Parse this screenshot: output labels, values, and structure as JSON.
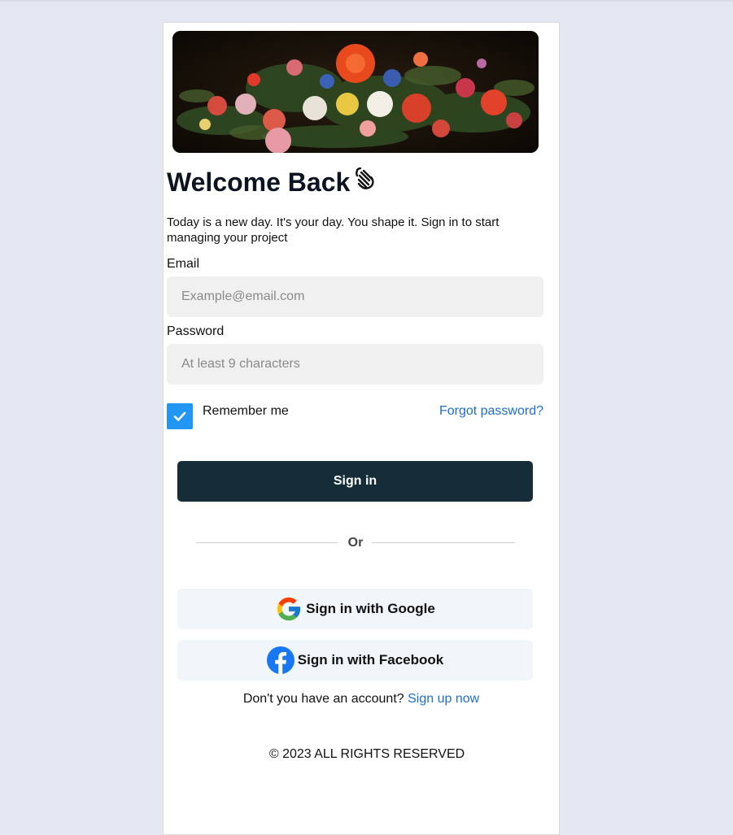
{
  "hero": {
    "alt": "Still life painting of a flower bouquet"
  },
  "header": {
    "title": "Welcome Back",
    "wave_icon": "waving-hand-icon",
    "subtitle": "Today is a new day. It's your day. You shape it. Sign in to start managing your project"
  },
  "form": {
    "email_label": "Email",
    "email_placeholder": "Example@email.com",
    "email_value": "",
    "password_label": "Password",
    "password_placeholder": "At least 9 characters",
    "password_value": "",
    "remember_label": "Remember me",
    "remember_checked": true,
    "forgot_label": "Forgot password?",
    "signin_label": "Sign in"
  },
  "divider": {
    "label": "Or"
  },
  "social": {
    "google_label": "Sign in with Google",
    "google_icon": "google-logo-icon",
    "facebook_label": "Sign in with Facebook",
    "facebook_icon": "facebook-logo-icon"
  },
  "signup": {
    "prompt": "Don't you have an account?",
    "link_label": "Sign up now"
  },
  "footer": {
    "copyright": "© 2023 ALL RIGHTS RESERVED"
  },
  "colors": {
    "page_background": "#e4e6f2",
    "primary_button": "#152c39",
    "link": "#1e6ecf",
    "checkbox": "#2196f3",
    "input_background": "#f0f0f0",
    "social_button_background": "#f1f6fa"
  }
}
